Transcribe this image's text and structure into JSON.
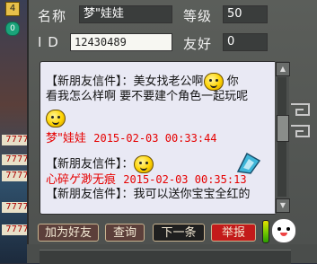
{
  "side": {
    "badge": "4",
    "tag": "0",
    "strips": [
      "7777",
      "7777",
      "7777",
      "7777",
      "7777"
    ]
  },
  "profile": {
    "name_label": "名称",
    "name_value": "梦\"娃娃",
    "level_label": "等级",
    "level_value": "50",
    "id_label": "I D",
    "id_value": "12430489",
    "friend_label": "友好",
    "friend_value": "0"
  },
  "messages": [
    {
      "prefix": "【新朋友信件】：",
      "text": "美女找老公啊",
      "suffix": " 你"
    },
    {
      "text": "看我怎么样啊 要不要建个角色一起玩呢"
    },
    {
      "sender": "梦\"娃娃",
      "time": "2015-02-03 00:33:44"
    },
    {
      "prefix": "【新朋友信件】："
    },
    {
      "sender": "心碎ゲ渺无痕",
      "time": "2015-02-03 00:35:13"
    },
    {
      "prefix": "【新朋友信件】：",
      "text": "我可以送你宝宝全红的"
    }
  ],
  "buttons": {
    "add_friend": "加为好友",
    "query": "查询",
    "next": "下一条",
    "report": "举报"
  },
  "colors": {
    "accent_red": "#e60000",
    "panel": "#555855",
    "message_bg": "#e9e9f4"
  }
}
